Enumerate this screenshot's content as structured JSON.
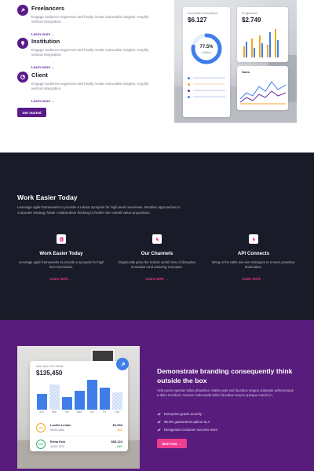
{
  "features": [
    {
      "title": "Freelancers",
      "text": "Engage audience segments and finally create actionable insights. Amplify vertical integration.",
      "link": "Learn more"
    },
    {
      "title": "Institution",
      "text": "Engage audience segments and finally create actionable insights. Amplify vertical integration.",
      "link": "Learn more"
    },
    {
      "title": "Client",
      "text": "Engage audience segments and finally create actionable insights. Amplify vertical integration.",
      "link": "Learn more"
    }
  ],
  "get_started_label": "Get started",
  "dashboard": {
    "completion": {
      "label": "Successful Completion",
      "value": "$6.127",
      "percent": "77.5%",
      "sub": "Fulfilled"
    },
    "progression": {
      "label": "Progression",
      "value": "$2.749"
    },
    "sales": {
      "label": "Sales"
    }
  },
  "work": {
    "title": "Work Easier Today",
    "lead": "Leverage agile frameworks to provide a robust synopsis for high level overviews. Iterative approaches to corporate strategy foster collaborative thinking to further the overall value proposition.",
    "columns": [
      {
        "title": "Work Easier Today",
        "text": "Leverage agile frameworks to provide a synopsis for high level overviews.",
        "link": "Learn more",
        "icon": "dollar-icon"
      },
      {
        "title": "Our Channels",
        "text": "Organically grow the holistic world view of disruptive innovation and amazing Concepts.",
        "link": "Learn more",
        "icon": "pointer-icon"
      },
      {
        "title": "API Connects",
        "text": "Bring to the table win-win strategies to ensure proactive domination.",
        "link": "Learn more",
        "icon": "pointer-icon"
      }
    ]
  },
  "branding": {
    "title": "Demonstrate branding consequently think outside the box",
    "desc": "Velit purus egestas tellus phasellus. Mattis eget sed faucibus magna vulputate pellentesque a diam tincidunt. Aenean malesuada tellus faucibus mauris quisque mauris in.",
    "checks": [
      "Enterprise-grade security",
      "99.9% guaranteed uptime SLA",
      "Designated customer success team"
    ],
    "button": "Start now"
  },
  "won_card": {
    "label": "Won from 153 Deals",
    "value": "$135,450",
    "days": [
      "Sun",
      "Mon",
      "Tue",
      "Wed",
      "Thu",
      "Fri",
      "Sat"
    ],
    "rows": [
      {
        "name": "Lucille Lemke",
        "id": "85083-9866",
        "amount": "$1,003",
        "percent": "40%",
        "ring": "40%",
        "color": "#f5a623"
      },
      {
        "name": "Erma Kub",
        "id": "46330-3576",
        "amount": "$68,124",
        "percent": "64%",
        "ring": "64%",
        "color": "#2fb56a"
      }
    ]
  },
  "colors": {
    "brand_purple": "#5a1a8a",
    "dark": "#191c28",
    "pink": "#ef3d8f",
    "blue": "#3f7ee8"
  }
}
